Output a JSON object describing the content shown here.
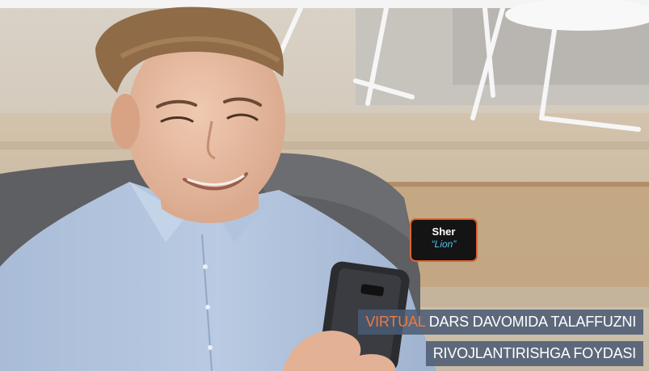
{
  "vocab_card": {
    "word": "Sher",
    "translation": "“Lion”",
    "border_color": "#e0632f"
  },
  "caption": {
    "line1_highlight": "VIRTUAL",
    "line1_rest": " DARS DAVOMIDA TALAFFUZNI",
    "line2": "RIVOJLANTIRISHGA FOYDASI",
    "highlight_color": "#f07a3c",
    "band_color": "#4a5b73"
  }
}
